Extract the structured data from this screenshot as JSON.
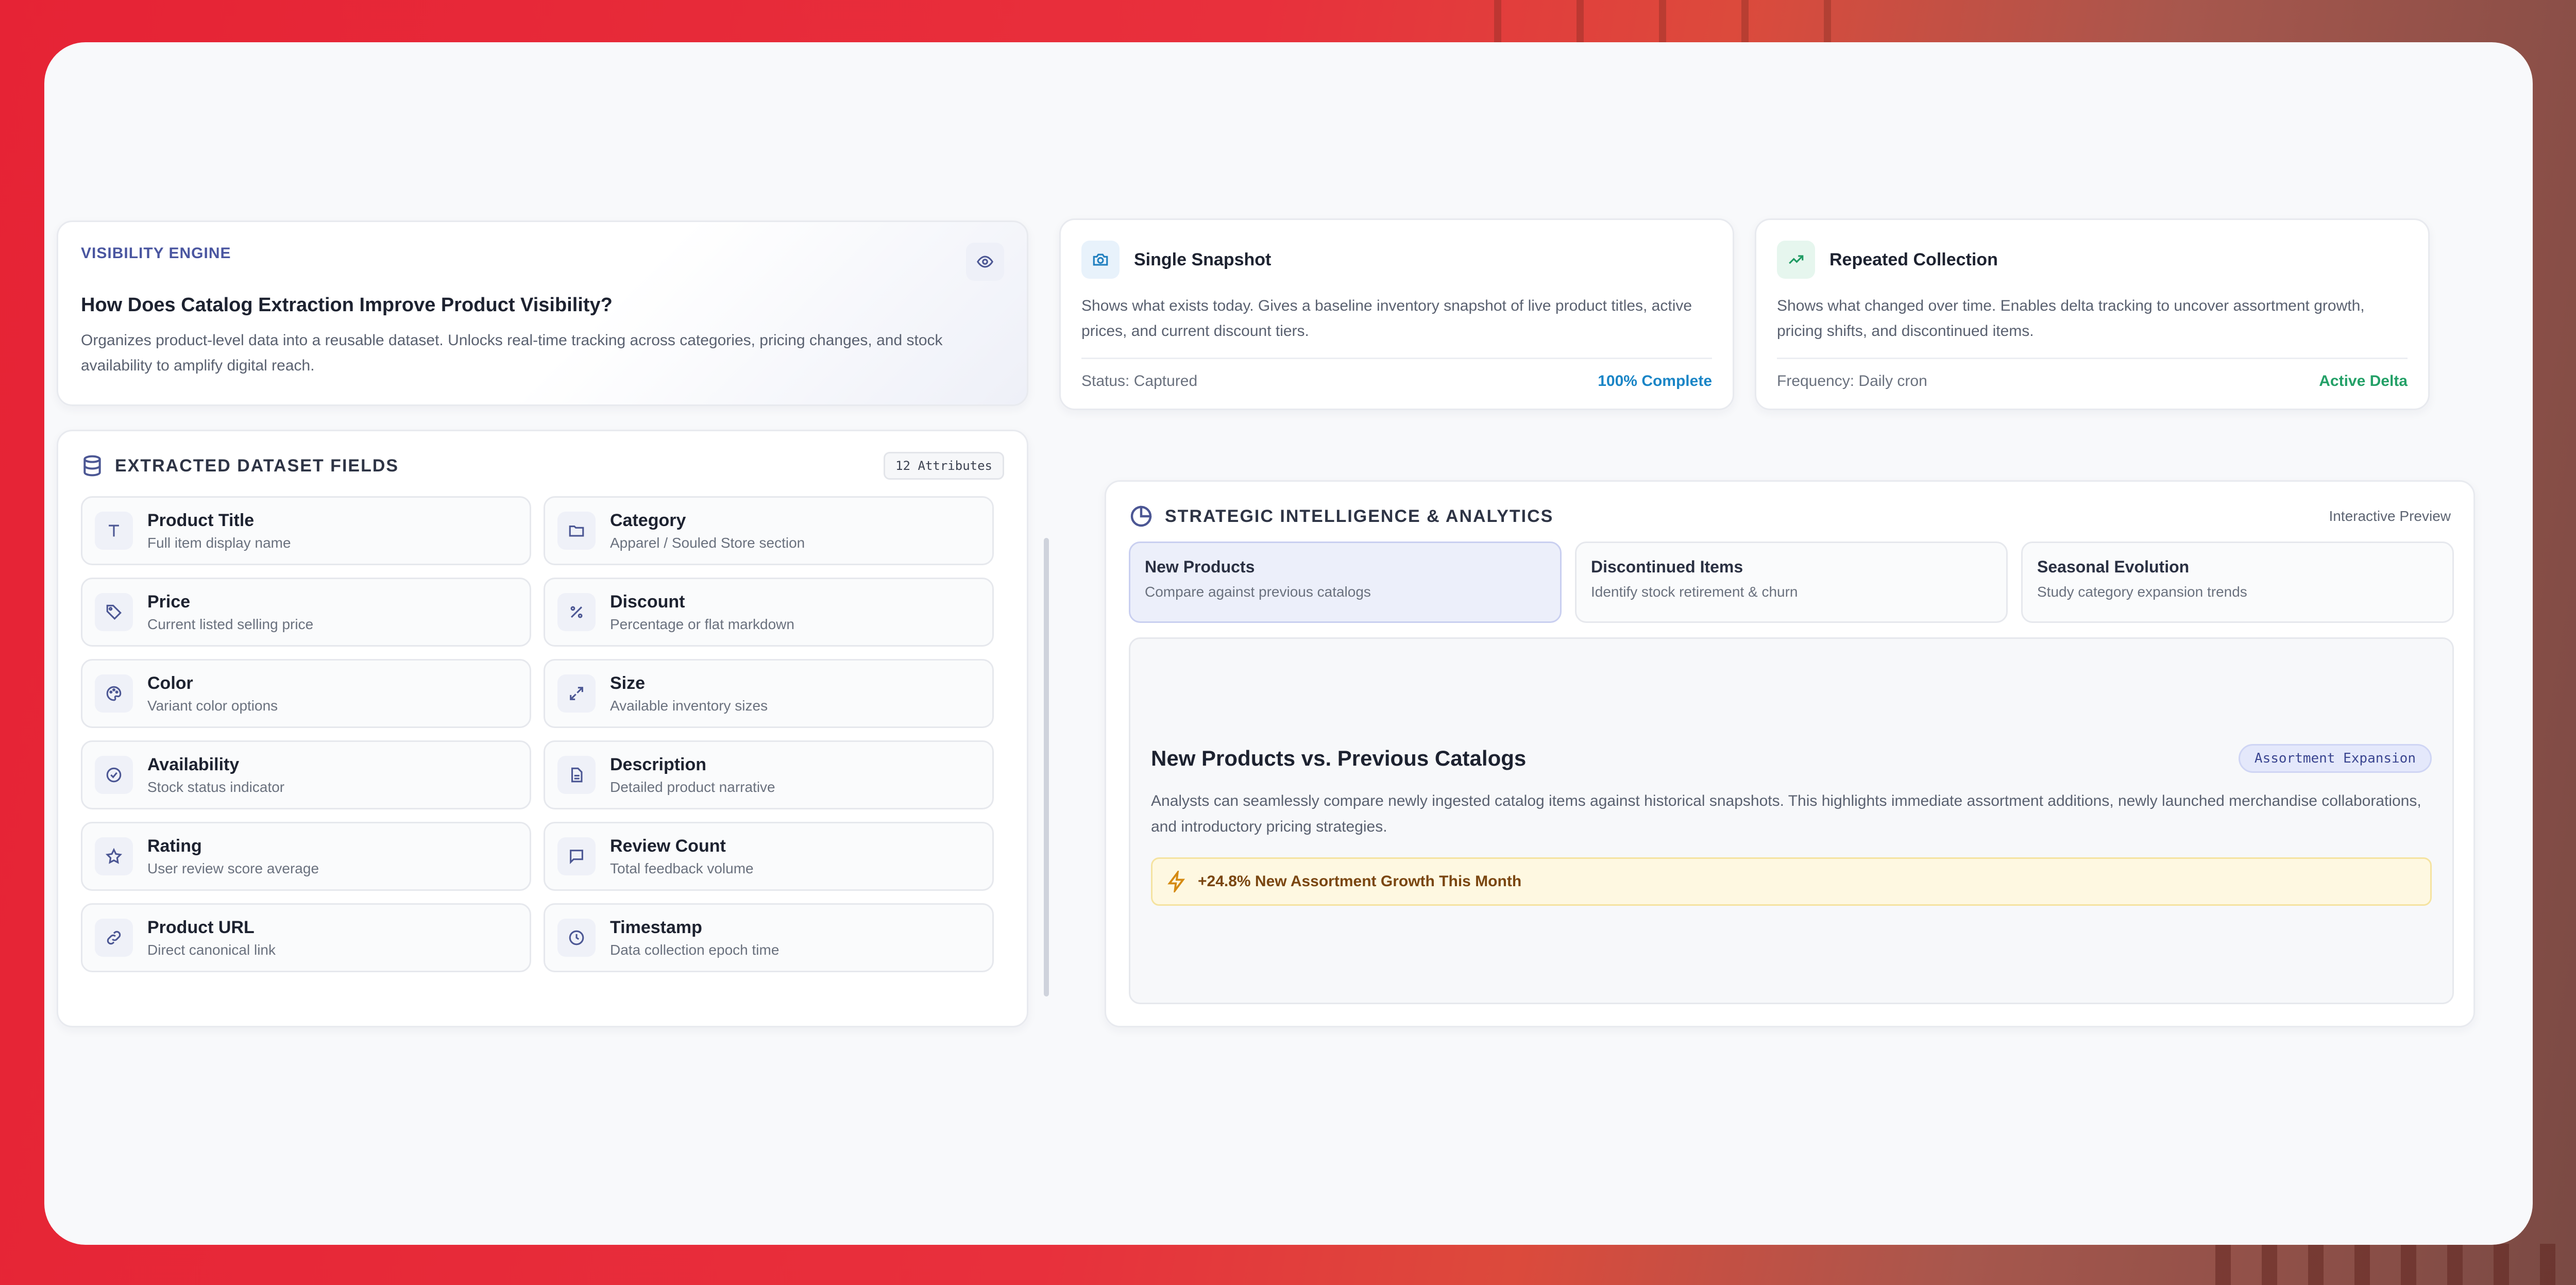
{
  "visibility": {
    "eyebrow": "VISIBILITY ENGINE",
    "title": "How Does Catalog Extraction Improve Product Visibility?",
    "description": "Organizes product-level data into a reusable dataset. Unlocks real-time tracking across categories, pricing changes, and stock availability to amplify digital reach.",
    "icon": "eye-icon"
  },
  "snapshot": {
    "title": "Single Snapshot",
    "icon": "camera-icon",
    "description": "Shows what exists today. Gives a baseline inventory snapshot of live product titles, active prices, and current discount tiers.",
    "status": "Status: Captured",
    "progress": "100% Complete",
    "accent": "#1a85c6"
  },
  "repeated": {
    "title": "Repeated Collection",
    "icon": "trending-up-icon",
    "description": "Shows what changed over time. Enables delta tracking to uncover assortment growth, pricing shifts, and discontinued items.",
    "frequency": "Frequency: Daily cron",
    "state": "Active Delta",
    "accent": "#23a067"
  },
  "fields": {
    "title": "EXTRACTED DATASET FIELDS",
    "badge": "12 Attributes",
    "items": [
      {
        "name": "Product Title",
        "desc": "Full item display name",
        "icon": "text-icon"
      },
      {
        "name": "Category",
        "desc": "Apparel / Souled Store section",
        "icon": "folder-icon"
      },
      {
        "name": "Price",
        "desc": "Current listed selling price",
        "icon": "tag-icon"
      },
      {
        "name": "Discount",
        "desc": "Percentage or flat markdown",
        "icon": "percent-icon"
      },
      {
        "name": "Color",
        "desc": "Variant color options",
        "icon": "palette-icon"
      },
      {
        "name": "Size",
        "desc": "Available inventory sizes",
        "icon": "expand-icon"
      },
      {
        "name": "Availability",
        "desc": "Stock status indicator",
        "icon": "check-circle-icon"
      },
      {
        "name": "Description",
        "desc": "Detailed product narrative",
        "icon": "document-icon"
      },
      {
        "name": "Rating",
        "desc": "User review score average",
        "icon": "star-icon"
      },
      {
        "name": "Review Count",
        "desc": "Total feedback volume",
        "icon": "message-icon"
      },
      {
        "name": "Product URL",
        "desc": "Direct canonical link",
        "icon": "link-icon"
      },
      {
        "name": "Timestamp",
        "desc": "Data collection epoch time",
        "icon": "clock-icon"
      }
    ]
  },
  "analytics": {
    "title": "STRATEGIC INTELLIGENCE & ANALYTICS",
    "preview_label": "Interactive Preview",
    "tabs": [
      {
        "name": "New Products",
        "desc": "Compare against previous catalogs",
        "active": true
      },
      {
        "name": "Discontinued Items",
        "desc": "Identify stock retirement & churn",
        "active": false
      },
      {
        "name": "Seasonal Evolution",
        "desc": "Study category expansion trends",
        "active": false
      }
    ],
    "detail": {
      "title": "New Products vs. Previous Catalogs",
      "tag": "Assortment Expansion",
      "description": "Analysts can seamlessly compare newly ingested catalog items against historical snapshots. This highlights immediate assortment additions, newly launched merchandise collaborations, and introductory pricing strategies.",
      "alert": "+24.8% New Assortment Growth This Month"
    }
  }
}
